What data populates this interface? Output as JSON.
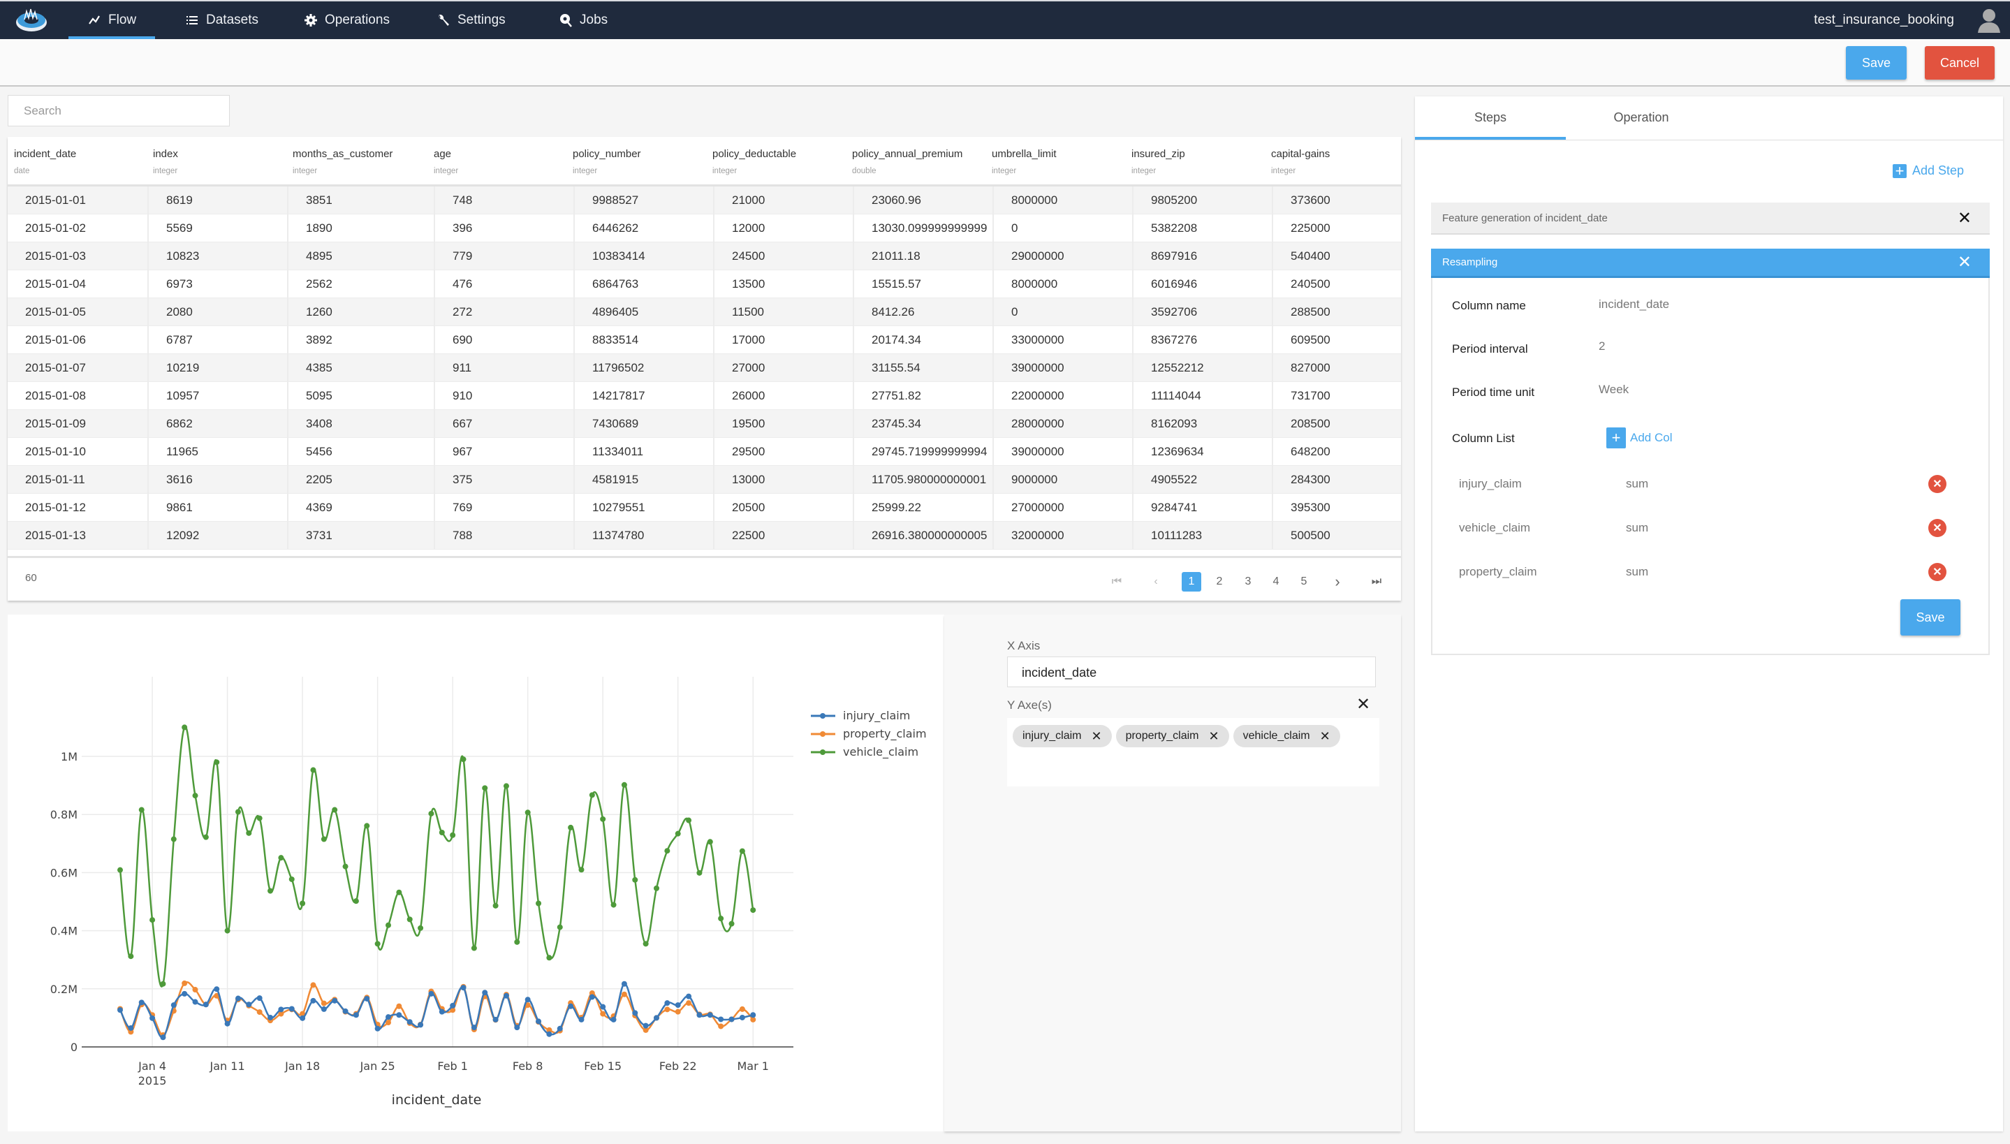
{
  "nav": {
    "items": [
      {
        "label": "Flow",
        "icon": "chart-line-icon",
        "active": true
      },
      {
        "label": "Datasets",
        "icon": "list-icon"
      },
      {
        "label": "Operations",
        "icon": "gear-icon"
      },
      {
        "label": "Settings",
        "icon": "wrench-icon"
      },
      {
        "label": "Jobs",
        "icon": "search-gear-icon"
      }
    ],
    "username": "test_insurance_booking"
  },
  "toolbar": {
    "save_label": "Save",
    "cancel_label": "Cancel"
  },
  "search": {
    "placeholder": "Search",
    "value": ""
  },
  "table": {
    "columns": [
      {
        "name": "incident_date",
        "type": "date"
      },
      {
        "name": "index",
        "type": "integer"
      },
      {
        "name": "months_as_customer",
        "type": "integer"
      },
      {
        "name": "age",
        "type": "integer"
      },
      {
        "name": "policy_number",
        "type": "integer"
      },
      {
        "name": "policy_deductable",
        "type": "integer"
      },
      {
        "name": "policy_annual_premium",
        "type": "double"
      },
      {
        "name": "umbrella_limit",
        "type": "integer"
      },
      {
        "name": "insured_zip",
        "type": "integer"
      },
      {
        "name": "capital-gains",
        "type": "integer"
      }
    ],
    "rows": [
      [
        "2015-01-01",
        "8619",
        "3851",
        "748",
        "9988527",
        "21000",
        "23060.96",
        "8000000",
        "9805200",
        "373600"
      ],
      [
        "2015-01-02",
        "5569",
        "1890",
        "396",
        "6446262",
        "12000",
        "13030.099999999999",
        "0",
        "5382208",
        "225000"
      ],
      [
        "2015-01-03",
        "10823",
        "4895",
        "779",
        "10383414",
        "24500",
        "21011.18",
        "29000000",
        "8697916",
        "540400"
      ],
      [
        "2015-01-04",
        "6973",
        "2562",
        "476",
        "6864763",
        "13500",
        "15515.57",
        "8000000",
        "6016946",
        "240500"
      ],
      [
        "2015-01-05",
        "2080",
        "1260",
        "272",
        "4896405",
        "11500",
        "8412.26",
        "0",
        "3592706",
        "288500"
      ],
      [
        "2015-01-06",
        "6787",
        "3892",
        "690",
        "8833514",
        "17000",
        "20174.34",
        "33000000",
        "8367276",
        "609500"
      ],
      [
        "2015-01-07",
        "10219",
        "4385",
        "911",
        "11796502",
        "27000",
        "31155.54",
        "39000000",
        "12552212",
        "827000"
      ],
      [
        "2015-01-08",
        "10957",
        "5095",
        "910",
        "14217817",
        "26000",
        "27751.82",
        "22000000",
        "11114044",
        "731700"
      ],
      [
        "2015-01-09",
        "6862",
        "3408",
        "667",
        "7430689",
        "19500",
        "23745.34",
        "28000000",
        "8162093",
        "208500"
      ],
      [
        "2015-01-10",
        "11965",
        "5456",
        "967",
        "11334011",
        "29500",
        "29745.719999999994",
        "39000000",
        "12369634",
        "648200"
      ],
      [
        "2015-01-11",
        "3616",
        "2205",
        "375",
        "4581915",
        "13000",
        "11705.980000000001",
        "9000000",
        "4905522",
        "284300"
      ],
      [
        "2015-01-12",
        "9861",
        "4369",
        "769",
        "10279551",
        "20500",
        "25999.22",
        "27000000",
        "9284741",
        "395300"
      ],
      [
        "2015-01-13",
        "12092",
        "3731",
        "788",
        "11374780",
        "22500",
        "26916.380000000005",
        "32000000",
        "10111283",
        "500500"
      ]
    ],
    "total_count": "60",
    "pagination": {
      "pages": [
        "1",
        "2",
        "3",
        "4",
        "5"
      ],
      "current": "1"
    }
  },
  "axes_panel": {
    "x_axis_label": "X Axis",
    "x_axis_value": "incident_date",
    "y_axes_label": "Y Axe(s)",
    "y_axes": [
      "injury_claim",
      "property_claim",
      "vehicle_claim"
    ]
  },
  "chart_data": {
    "type": "line",
    "xlabel": "incident_date",
    "ylabel": "",
    "x_start": "2015-01-01",
    "x_end": "2015-03-01",
    "x_ticks": [
      "Jan 4",
      "Jan 11",
      "Jan 18",
      "Jan 25",
      "Feb 1",
      "Feb 8",
      "Feb 15",
      "Feb 22",
      "Mar 1"
    ],
    "x_tick_dates": [
      "2015-01-04",
      "2015-01-11",
      "2015-01-18",
      "2015-01-25",
      "2015-02-01",
      "2015-02-08",
      "2015-02-15",
      "2015-02-22",
      "2015-03-01"
    ],
    "x_year_label": "2015",
    "y_ticks": [
      "0",
      "0.2M",
      "0.4M",
      "0.6M",
      "0.8M",
      "1M"
    ],
    "y_tick_values": [
      0,
      200000,
      400000,
      600000,
      800000,
      1000000
    ],
    "ylim": [
      0,
      1150000
    ],
    "grid": true,
    "legend_position": "top-right",
    "series": [
      {
        "name": "injury_claim",
        "color": "#3a78b8",
        "values": [
          127000,
          65000,
          153000,
          99000,
          33000,
          144000,
          183000,
          155000,
          146000,
          199000,
          80000,
          167000,
          146000,
          168000,
          101000,
          129000,
          131000,
          99000,
          159000,
          130000,
          159000,
          123000,
          110000,
          166000,
          63000,
          103000,
          110000,
          86000,
          76000,
          183000,
          121000,
          142000,
          204000,
          67000,
          187000,
          94000,
          176000,
          67000,
          163000,
          88000,
          44000,
          63000,
          140000,
          94000,
          172000,
          138000,
          94000,
          217000,
          117000,
          73000,
          100000,
          151000,
          144000,
          174000,
          110000,
          110000,
          95000,
          95000,
          101000,
          110000
        ]
      },
      {
        "name": "property_claim",
        "color": "#f08a35",
        "values": [
          131000,
          52000,
          146000,
          110000,
          41000,
          124000,
          219000,
          197000,
          146000,
          176000,
          91000,
          163000,
          142000,
          120000,
          91000,
          114000,
          129000,
          114000,
          213000,
          150000,
          163000,
          121000,
          114000,
          170000,
          77000,
          84000,
          140000,
          82000,
          77000,
          191000,
          131000,
          127000,
          207000,
          60000,
          174000,
          93000,
          180000,
          73000,
          144000,
          86000,
          58000,
          56000,
          151000,
          101000,
          185000,
          114000,
          106000,
          181000,
          108000,
          58000,
          100000,
          129000,
          121000,
          151000,
          112000,
          112000,
          71000,
          95000,
          130000,
          94000
        ]
      },
      {
        "name": "vehicle_claim",
        "color": "#4e9a3a",
        "values": [
          609000,
          312000,
          816000,
          437000,
          217000,
          715000,
          1100000,
          865000,
          722000,
          980000,
          400000,
          809000,
          736000,
          787000,
          537000,
          651000,
          577000,
          494000,
          953000,
          715000,
          816000,
          621000,
          502000,
          761000,
          355000,
          419000,
          532000,
          439000,
          409000,
          803000,
          738000,
          729000,
          990000,
          340000,
          891000,
          486000,
          898000,
          361000,
          807000,
          494000,
          307000,
          412000,
          755000,
          610000,
          867000,
          784000,
          489000,
          902000,
          575000,
          355000,
          546000,
          675000,
          734000,
          780000,
          599000,
          706000,
          442000,
          424000,
          674000,
          471000
        ]
      }
    ]
  },
  "right_panel": {
    "tabs": [
      "Steps",
      "Operation"
    ],
    "active_tab": "Steps",
    "add_step_label": "Add Step",
    "steps": [
      {
        "title": "Feature generation of incident_date",
        "expanded": false
      },
      {
        "title": "Resampling",
        "expanded": true
      }
    ],
    "resampling": {
      "column_name_label": "Column name",
      "column_name": "incident_date",
      "period_interval_label": "Period interval",
      "period_interval": "2",
      "period_unit_label": "Period time unit",
      "period_unit": "Week",
      "column_list_label": "Column List",
      "add_col_label": "Add Col",
      "columns": [
        {
          "name": "injury_claim",
          "agg": "sum"
        },
        {
          "name": "vehicle_claim",
          "agg": "sum"
        },
        {
          "name": "property_claim",
          "agg": "sum"
        }
      ],
      "save_label": "Save"
    }
  },
  "colors": {
    "nav_bg": "#1f2a3d",
    "accent": "#4aa8ec",
    "danger": "#e2533f"
  }
}
